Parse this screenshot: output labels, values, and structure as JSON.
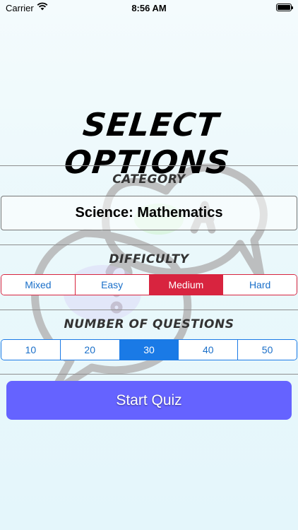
{
  "status_bar": {
    "carrier": "Carrier",
    "time": "8:56 AM"
  },
  "title": "SELECT OPTIONS",
  "category": {
    "label": "CATEGORY",
    "selected": "Science: Mathematics"
  },
  "difficulty": {
    "label": "DIFFICULTY",
    "options": [
      "Mixed",
      "Easy",
      "Medium",
      "Hard"
    ],
    "selected": "Medium",
    "accent": "#d8243f"
  },
  "questions": {
    "label": "NUMBER OF QUESTIONS",
    "options": [
      "10",
      "20",
      "30",
      "40",
      "50"
    ],
    "selected": "30",
    "accent": "#1a7ae6"
  },
  "start_button": {
    "label": "Start Quiz",
    "color": "#6563ff"
  }
}
